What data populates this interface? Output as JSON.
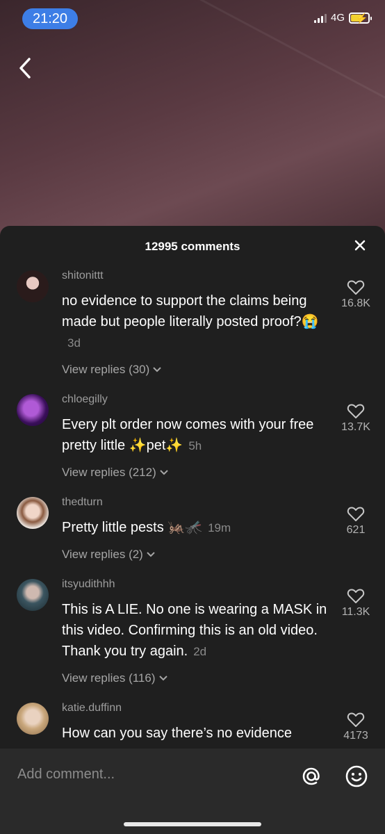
{
  "status_bar": {
    "time": "21:20",
    "network": "4G"
  },
  "sheet": {
    "title": "12995 comments"
  },
  "comments": [
    {
      "username": "shitonittt",
      "text": "no evidence to support the claims being made but people literally posted proof?😭",
      "age": "3d",
      "replies": "View replies (30)",
      "likes": "16.8K"
    },
    {
      "username": "chloegilly",
      "text": "Every plt order now comes with your free pretty little ✨pet✨",
      "age": "5h",
      "replies": "View replies (212)",
      "likes": "13.7K"
    },
    {
      "username": "thedturn",
      "text": "Pretty little pests 🦗🦟",
      "age": "19m",
      "replies": "View replies (2)",
      "likes": "621"
    },
    {
      "username": "itsyudithhh",
      "text": "This is A LIE. No one is wearing a MASK in this video. Confirming this is an old video. Thank you try again.",
      "age": "2d",
      "replies": "View replies (116)",
      "likes": "11.3K"
    },
    {
      "username": "katie.duffinn",
      "text": "How can you say there’s no evidence",
      "age": "",
      "replies": "",
      "likes": "4173"
    }
  ],
  "composer": {
    "placeholder": "Add comment..."
  },
  "icons": {
    "back": "chevron-left-icon",
    "close": "close-icon",
    "like": "heart-outline-icon",
    "mention": "at-sign-icon",
    "emoji": "smiley-icon"
  },
  "colors": {
    "time_pill": "#3d7ee6",
    "battery": "#f3d230",
    "sheet_bg": "#1f1f1f"
  }
}
